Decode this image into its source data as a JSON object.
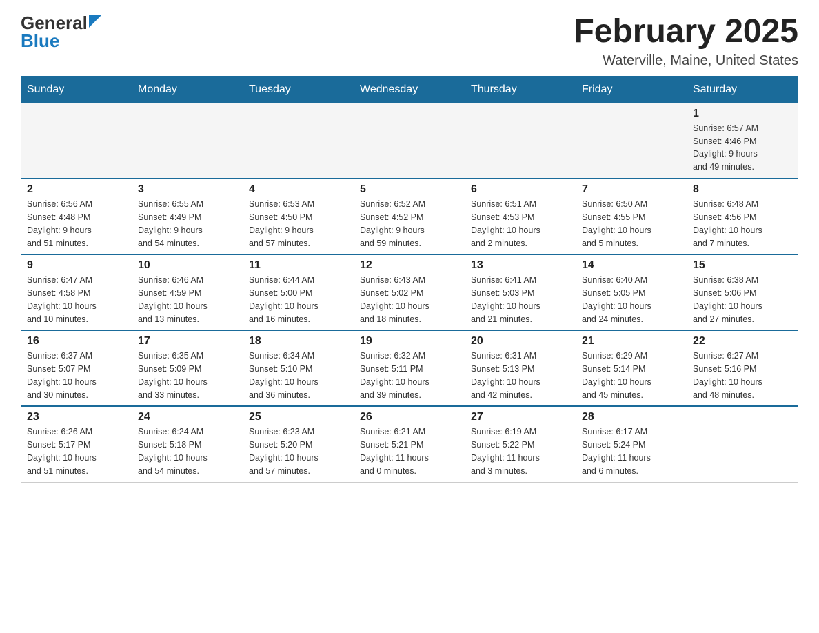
{
  "logo": {
    "general": "General",
    "blue": "Blue"
  },
  "title": "February 2025",
  "location": "Waterville, Maine, United States",
  "days_of_week": [
    "Sunday",
    "Monday",
    "Tuesday",
    "Wednesday",
    "Thursday",
    "Friday",
    "Saturday"
  ],
  "weeks": [
    [
      {
        "day": "",
        "info": ""
      },
      {
        "day": "",
        "info": ""
      },
      {
        "day": "",
        "info": ""
      },
      {
        "day": "",
        "info": ""
      },
      {
        "day": "",
        "info": ""
      },
      {
        "day": "",
        "info": ""
      },
      {
        "day": "1",
        "info": "Sunrise: 6:57 AM\nSunset: 4:46 PM\nDaylight: 9 hours\nand 49 minutes."
      }
    ],
    [
      {
        "day": "2",
        "info": "Sunrise: 6:56 AM\nSunset: 4:48 PM\nDaylight: 9 hours\nand 51 minutes."
      },
      {
        "day": "3",
        "info": "Sunrise: 6:55 AM\nSunset: 4:49 PM\nDaylight: 9 hours\nand 54 minutes."
      },
      {
        "day": "4",
        "info": "Sunrise: 6:53 AM\nSunset: 4:50 PM\nDaylight: 9 hours\nand 57 minutes."
      },
      {
        "day": "5",
        "info": "Sunrise: 6:52 AM\nSunset: 4:52 PM\nDaylight: 9 hours\nand 59 minutes."
      },
      {
        "day": "6",
        "info": "Sunrise: 6:51 AM\nSunset: 4:53 PM\nDaylight: 10 hours\nand 2 minutes."
      },
      {
        "day": "7",
        "info": "Sunrise: 6:50 AM\nSunset: 4:55 PM\nDaylight: 10 hours\nand 5 minutes."
      },
      {
        "day": "8",
        "info": "Sunrise: 6:48 AM\nSunset: 4:56 PM\nDaylight: 10 hours\nand 7 minutes."
      }
    ],
    [
      {
        "day": "9",
        "info": "Sunrise: 6:47 AM\nSunset: 4:58 PM\nDaylight: 10 hours\nand 10 minutes."
      },
      {
        "day": "10",
        "info": "Sunrise: 6:46 AM\nSunset: 4:59 PM\nDaylight: 10 hours\nand 13 minutes."
      },
      {
        "day": "11",
        "info": "Sunrise: 6:44 AM\nSunset: 5:00 PM\nDaylight: 10 hours\nand 16 minutes."
      },
      {
        "day": "12",
        "info": "Sunrise: 6:43 AM\nSunset: 5:02 PM\nDaylight: 10 hours\nand 18 minutes."
      },
      {
        "day": "13",
        "info": "Sunrise: 6:41 AM\nSunset: 5:03 PM\nDaylight: 10 hours\nand 21 minutes."
      },
      {
        "day": "14",
        "info": "Sunrise: 6:40 AM\nSunset: 5:05 PM\nDaylight: 10 hours\nand 24 minutes."
      },
      {
        "day": "15",
        "info": "Sunrise: 6:38 AM\nSunset: 5:06 PM\nDaylight: 10 hours\nand 27 minutes."
      }
    ],
    [
      {
        "day": "16",
        "info": "Sunrise: 6:37 AM\nSunset: 5:07 PM\nDaylight: 10 hours\nand 30 minutes."
      },
      {
        "day": "17",
        "info": "Sunrise: 6:35 AM\nSunset: 5:09 PM\nDaylight: 10 hours\nand 33 minutes."
      },
      {
        "day": "18",
        "info": "Sunrise: 6:34 AM\nSunset: 5:10 PM\nDaylight: 10 hours\nand 36 minutes."
      },
      {
        "day": "19",
        "info": "Sunrise: 6:32 AM\nSunset: 5:11 PM\nDaylight: 10 hours\nand 39 minutes."
      },
      {
        "day": "20",
        "info": "Sunrise: 6:31 AM\nSunset: 5:13 PM\nDaylight: 10 hours\nand 42 minutes."
      },
      {
        "day": "21",
        "info": "Sunrise: 6:29 AM\nSunset: 5:14 PM\nDaylight: 10 hours\nand 45 minutes."
      },
      {
        "day": "22",
        "info": "Sunrise: 6:27 AM\nSunset: 5:16 PM\nDaylight: 10 hours\nand 48 minutes."
      }
    ],
    [
      {
        "day": "23",
        "info": "Sunrise: 6:26 AM\nSunset: 5:17 PM\nDaylight: 10 hours\nand 51 minutes."
      },
      {
        "day": "24",
        "info": "Sunrise: 6:24 AM\nSunset: 5:18 PM\nDaylight: 10 hours\nand 54 minutes."
      },
      {
        "day": "25",
        "info": "Sunrise: 6:23 AM\nSunset: 5:20 PM\nDaylight: 10 hours\nand 57 minutes."
      },
      {
        "day": "26",
        "info": "Sunrise: 6:21 AM\nSunset: 5:21 PM\nDaylight: 11 hours\nand 0 minutes."
      },
      {
        "day": "27",
        "info": "Sunrise: 6:19 AM\nSunset: 5:22 PM\nDaylight: 11 hours\nand 3 minutes."
      },
      {
        "day": "28",
        "info": "Sunrise: 6:17 AM\nSunset: 5:24 PM\nDaylight: 11 hours\nand 6 minutes."
      },
      {
        "day": "",
        "info": ""
      }
    ]
  ]
}
